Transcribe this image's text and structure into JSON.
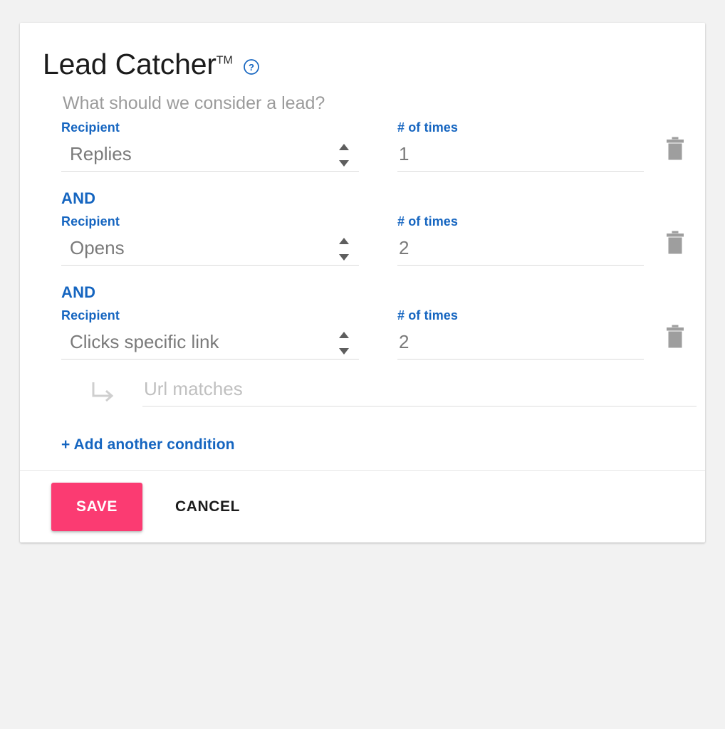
{
  "card": {
    "title": "Lead Catcher",
    "title_trademark": "TM",
    "help_icon_label": "?",
    "question": "What should we consider a lead?",
    "and_label": "AND",
    "conditions": [
      {
        "recipient_label": "Recipient",
        "recipient_value": "Replies",
        "times_label": "# of times",
        "times_value": "1"
      },
      {
        "recipient_label": "Recipient",
        "recipient_value": "Opens",
        "times_label": "# of times",
        "times_value": "2"
      },
      {
        "recipient_label": "Recipient",
        "recipient_value": "Clicks specific link",
        "times_label": "# of times",
        "times_value": "2"
      }
    ],
    "url_input": {
      "placeholder": "Url matches",
      "value": ""
    },
    "add_condition_label": "+ Add another condition",
    "footer": {
      "save_label": "SAVE",
      "cancel_label": "CANCEL"
    }
  },
  "colors": {
    "accent_blue": "#1565c0",
    "save_pink": "#fb3b72",
    "muted_gray": "#9b9b9b",
    "value_gray": "#7a7a7a",
    "placeholder_gray": "#c0c0c0",
    "page_background": "#f2f2f2",
    "card_background": "#ffffff"
  },
  "icons": {
    "help": "help-circle-icon",
    "delete": "trash-icon",
    "spinner": "spinner-arrows-icon",
    "sub_arrow": "sub-arrow-icon"
  }
}
